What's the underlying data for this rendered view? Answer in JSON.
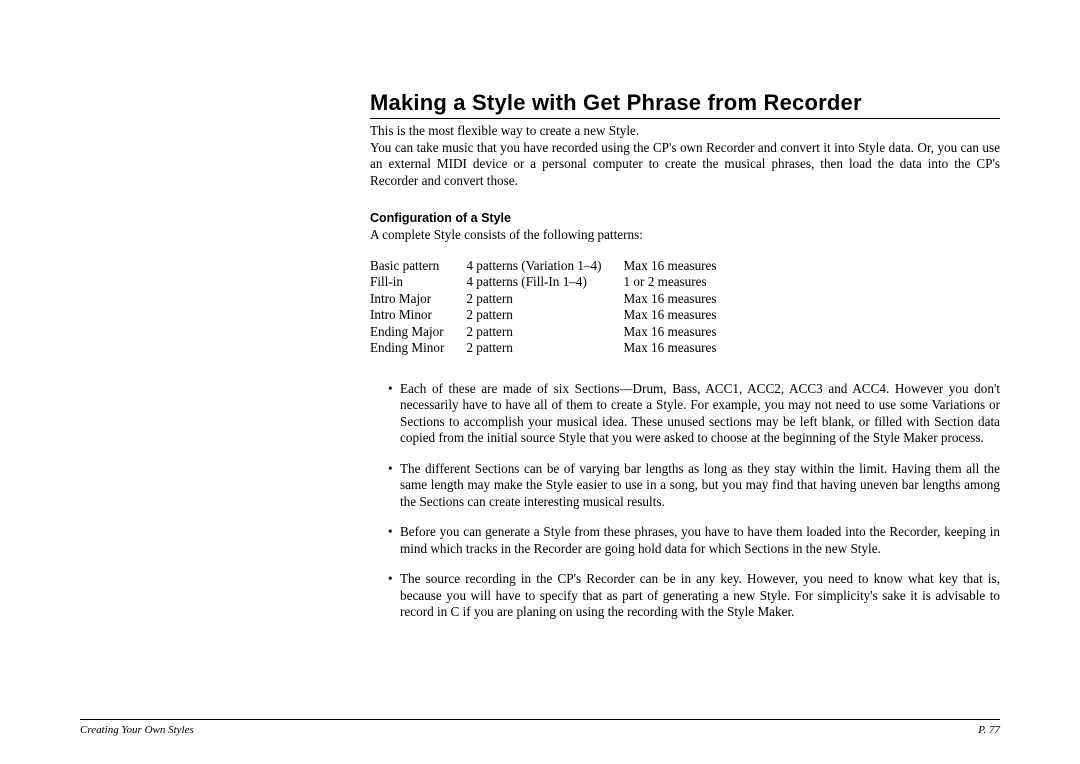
{
  "title": "Making a Style with Get Phrase from Recorder",
  "intro1": "This is the most flexible way to create a new Style.",
  "intro2": "You can take music that you have recorded using the CP's own Recorder and convert it into Style data. Or, you can use an external MIDI device or a personal computer to create the musical phrases, then load the data into the CP's Recorder and convert those.",
  "subhead": "Configuration of a Style",
  "config_intro": "A complete Style consists of the following patterns:",
  "rows": [
    {
      "name": "Basic pattern",
      "count": "4 patterns (Variation 1–4)",
      "meas": "Max 16 measures"
    },
    {
      "name": "Fill-in",
      "count": "4 patterns (Fill-In 1–4)",
      "meas": "1 or 2 measures"
    },
    {
      "name": "Intro Major",
      "count": "2 pattern",
      "meas": "Max 16 measures"
    },
    {
      "name": "Intro Minor",
      "count": "2 pattern",
      "meas": "Max 16 measures"
    },
    {
      "name": "Ending Major",
      "count": "2 pattern",
      "meas": "Max 16 measures"
    },
    {
      "name": "Ending Minor",
      "count": "2 pattern",
      "meas": "Max 16 measures"
    }
  ],
  "bullets": [
    "Each of these are made of six Sections—Drum, Bass, ACC1, ACC2, ACC3 and ACC4.  However you don't necessarily have to have all of them to create a Style.  For example, you may not need to use some Variations or Sections to accomplish your musical idea.  These unused sections may be left blank, or filled with Section data copied from the initial source Style that you were asked to choose at the beginning of the Style Maker process.",
    "The different Sections can be of varying bar lengths as long as they stay within the limit.  Having them all the same length may make the Style easier to use in a song, but you may find that having uneven bar lengths among the Sections can create interesting musical results.",
    "Before you can generate a Style from these phrases, you have to have them loaded into the Recorder, keeping in mind which tracks in the Recorder are going hold data for which Sections in the new Style.",
    "The source recording in the CP's Recorder can be in any key.  However, you need to know what key that is, because you will have to specify that as part of generating a new Style.  For simplicity's sake it is advisable to record in C if you are planing on using the recording with the Style Maker."
  ],
  "footer": {
    "left": "Creating Your Own Styles",
    "right": "P. 77"
  }
}
